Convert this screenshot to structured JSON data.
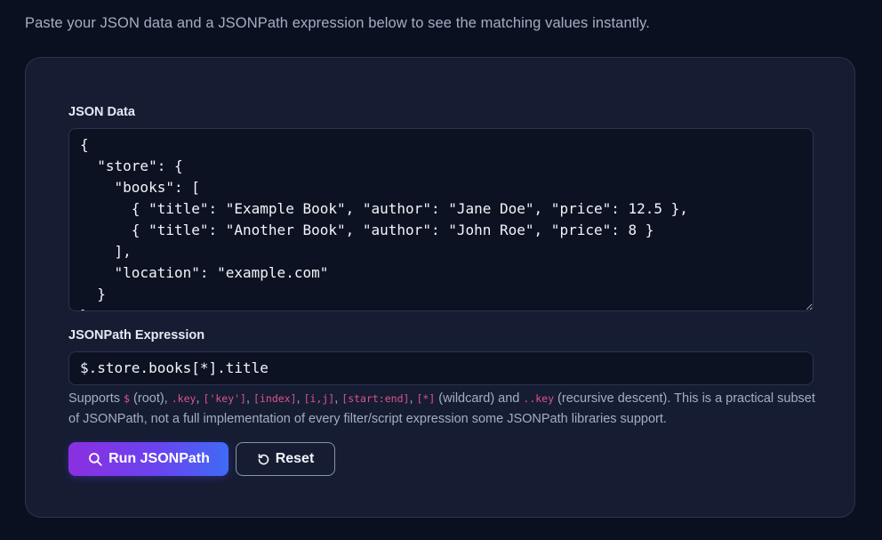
{
  "intro_text": "Paste your JSON data and a JSONPath expression below to see the matching values instantly.",
  "json_label": "JSON Data",
  "json_text": "{\n  \"store\": {\n    \"books\": [\n      { \"title\": \"Example Book\", \"author\": \"Jane Doe\", \"price\": 12.5 },\n      { \"title\": \"Another Book\", \"author\": \"John Roe\", \"price\": 8 }\n    ],\n    \"location\": \"example.com\"\n  }\n}",
  "path_label": "JSONPath Expression",
  "path_value": "$.store.books[*].title",
  "help": {
    "t0": "Supports ",
    "c_root": "$",
    "t1": " (root), ",
    "c_key": ".key",
    "t2": ", ",
    "c_bracket_key": "['key']",
    "t3": ", ",
    "c_index": "[index]",
    "t4": ", ",
    "c_union": "[i,j]",
    "t5": ", ",
    "c_slice": "[start:end]",
    "t6": ", ",
    "c_wild": "[*]",
    "t7": " (wildcard) and ",
    "c_recursive": "..key",
    "t8": " (recursive descent). This is a practical subset of JSONPath, not a full implementation of every filter/script expression some JSONPath libraries support."
  },
  "buttons": {
    "run_label": "Run JSONPath",
    "reset_label": "Reset"
  },
  "icons": {
    "run": "search-icon",
    "reset": "refresh-icon"
  },
  "colors": {
    "accent_start": "#8b2fe0",
    "accent_end": "#3f6bf5",
    "code_pink": "#e0528f"
  }
}
